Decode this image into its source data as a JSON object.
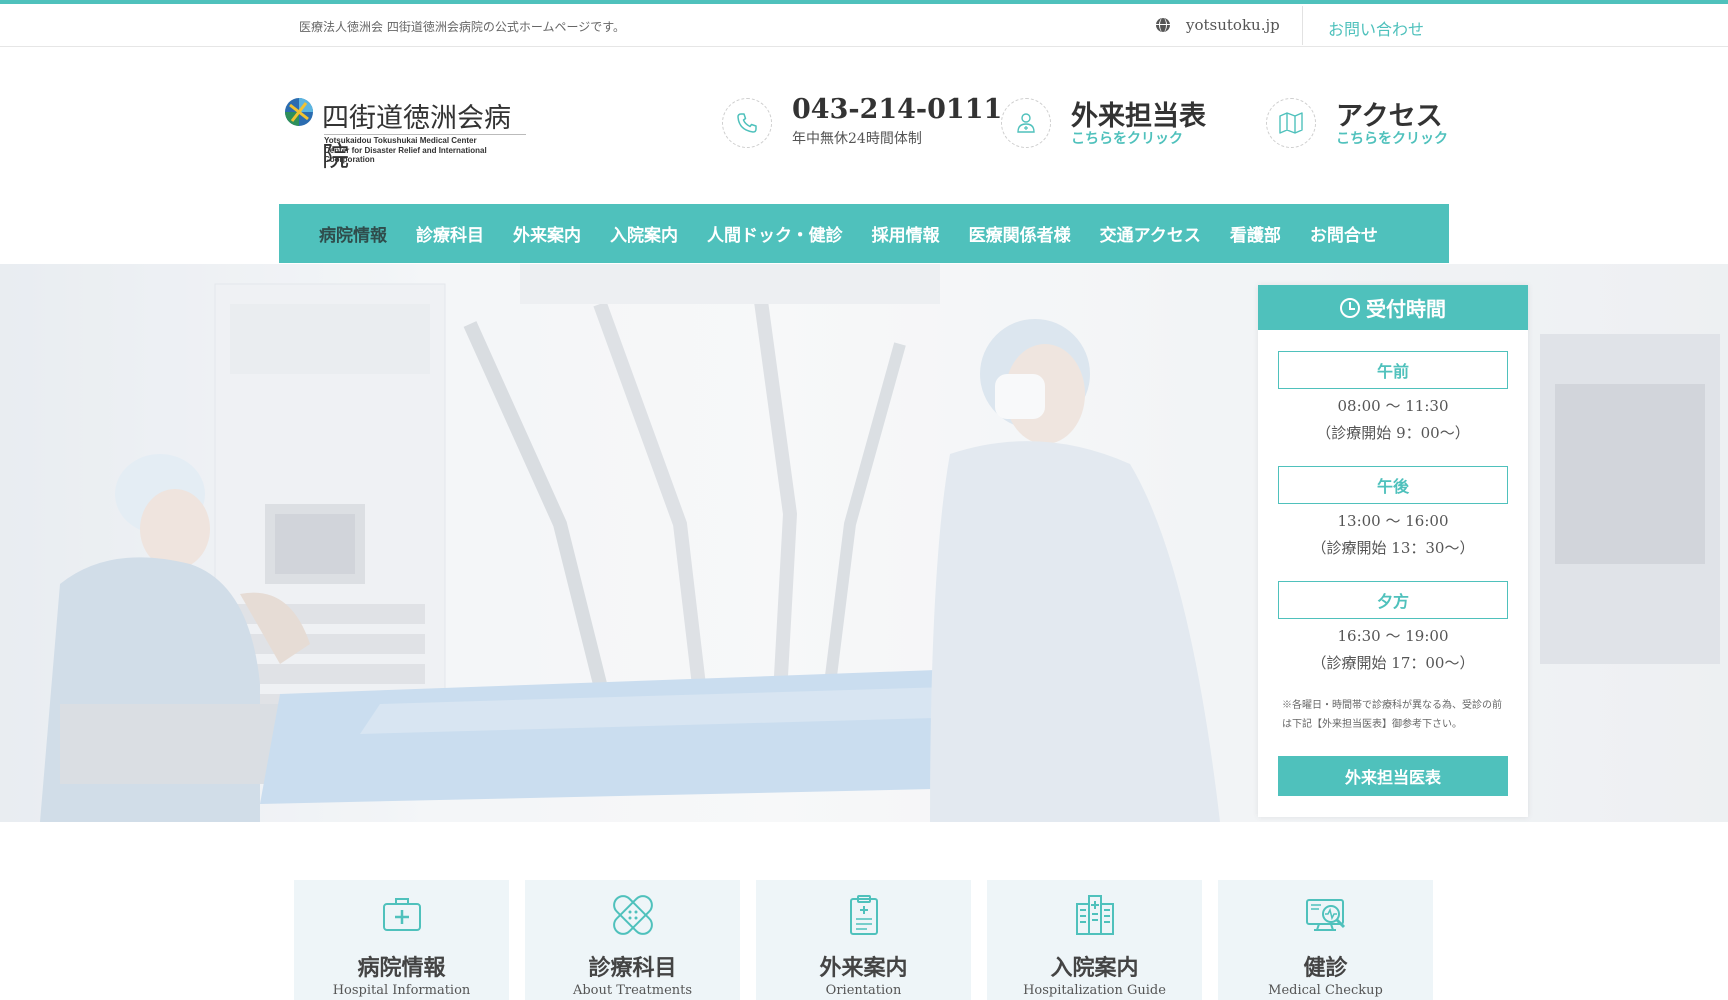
{
  "colors": {
    "accent": "#4fc1bc",
    "nav_active": "#2f4d4c",
    "card_bg": "#eef5f8"
  },
  "topbar": {
    "tagline": "医療法人徳洲会 四街道徳洲会病院の公式ホームページです。",
    "domain": "yotsutoku.jp",
    "contact": "お問い合わせ"
  },
  "logo": {
    "title": "四街道徳洲会病院",
    "sub1": "Yotsukaidou Tokushukai Medical Center",
    "sub2": "Center for Disaster Relief and International Coorporation"
  },
  "header": {
    "phone": {
      "icon": "phone-icon",
      "title": "043-214-0111",
      "sub": "年中無休24時間体制"
    },
    "schedule": {
      "icon": "doctor-icon",
      "title": "外来担当表",
      "sub": "こちらをクリック"
    },
    "access": {
      "icon": "map-icon",
      "title": "アクセス",
      "sub": "こちらをクリック"
    }
  },
  "nav": {
    "items": [
      {
        "label": "病院情報",
        "active": true
      },
      {
        "label": "診療科目"
      },
      {
        "label": "外来案内"
      },
      {
        "label": "入院案内"
      },
      {
        "label": "人間ドック・健診"
      },
      {
        "label": "採用情報"
      },
      {
        "label": "医療関係者様"
      },
      {
        "label": "交通アクセス"
      },
      {
        "label": "看護部"
      },
      {
        "label": "お問合せ"
      }
    ]
  },
  "reception": {
    "title": "受付時間",
    "slots": [
      {
        "label": "午前",
        "time": "08:00 ～ 11:30",
        "start": "（診療開始 9：00～）"
      },
      {
        "label": "午後",
        "time": "13:00 ～ 16:00",
        "start": "（診療開始 13：30～）"
      },
      {
        "label": "夕方",
        "time": "16:30 ～ 19:00",
        "start": "（診療開始 17：00～）"
      }
    ],
    "note": "※各曜日・時間帯で診療科が異なる為、受診の前は下記【外来担当医表】御参考下さい。",
    "button": "外来担当医表"
  },
  "cards": [
    {
      "icon": "medical-kit-icon",
      "title": "病院情報",
      "sub": "Hospital Information"
    },
    {
      "icon": "bandage-icon",
      "title": "診療科目",
      "sub": "About Treatments"
    },
    {
      "icon": "clipboard-icon",
      "title": "外来案内",
      "sub": "Orientation"
    },
    {
      "icon": "hospital-building-icon",
      "title": "入院案内",
      "sub": "Hospitalization Guide"
    },
    {
      "icon": "checkup-monitor-icon",
      "title": "健診",
      "sub": "Medical Checkup"
    }
  ]
}
